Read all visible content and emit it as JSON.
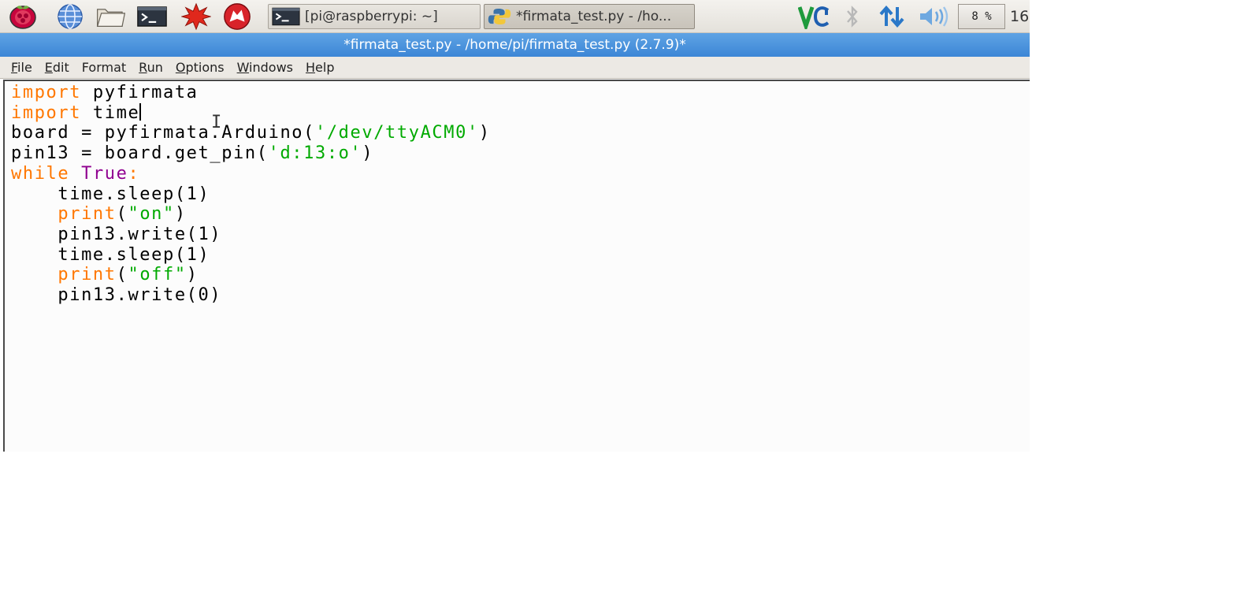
{
  "taskbar": {
    "launchers": [
      {
        "name": "raspberry-menu-icon"
      },
      {
        "name": "web-browser-icon"
      },
      {
        "name": "file-manager-icon"
      },
      {
        "name": "terminal-icon"
      },
      {
        "name": "mathematica-icon"
      },
      {
        "name": "wolfram-icon"
      }
    ],
    "tasks": [
      {
        "label": "[pi@raspberrypi: ~]",
        "icon": "terminal-icon",
        "active": false
      },
      {
        "label": "*firmata_test.py - /ho...",
        "icon": "python-icon",
        "active": true
      }
    ],
    "tray": {
      "vnc_icon": "vnc-icon",
      "bluetooth_icon": "bluetooth-icon",
      "network_icon": "network-icon",
      "volume_icon": "volume-icon",
      "cpu_value": "8",
      "cpu_unit": "%",
      "clock": "16"
    }
  },
  "window": {
    "title": "*firmata_test.py - /home/pi/firmata_test.py (2.7.9)*"
  },
  "menu": [
    {
      "mnemonic": "F",
      "rest": "ile"
    },
    {
      "mnemonic": "E",
      "rest": "dit"
    },
    {
      "mnemonic": "",
      "rest": "Format"
    },
    {
      "mnemonic": "R",
      "rest": "un"
    },
    {
      "mnemonic": "O",
      "rest": "ptions"
    },
    {
      "mnemonic": "W",
      "rest": "indows"
    },
    {
      "mnemonic": "H",
      "rest": "elp"
    }
  ],
  "editor": {
    "lines": [
      [
        {
          "t": "import",
          "c": "kw"
        },
        {
          "t": " pyfirmata",
          "c": ""
        }
      ],
      [
        {
          "t": "import",
          "c": "kw"
        },
        {
          "t": " time",
          "c": ""
        },
        {
          "t": "",
          "c": "caret"
        }
      ],
      [
        {
          "t": "board = pyfirmata.Arduino(",
          "c": ""
        },
        {
          "t": "'/dev/ttyACM0'",
          "c": "st"
        },
        {
          "t": ")",
          "c": ""
        }
      ],
      [
        {
          "t": "pin13 = board.get_pin(",
          "c": ""
        },
        {
          "t": "'d:13:o'",
          "c": "st"
        },
        {
          "t": ")",
          "c": ""
        }
      ],
      [
        {
          "t": "while",
          "c": "kw"
        },
        {
          "t": " ",
          "c": ""
        },
        {
          "t": "True",
          "c": "bi"
        },
        {
          "t": ":",
          "c": "kw"
        }
      ],
      [
        {
          "t": "    time.sleep(1)",
          "c": ""
        }
      ],
      [
        {
          "t": "    ",
          "c": ""
        },
        {
          "t": "print",
          "c": "kw"
        },
        {
          "t": "(",
          "c": ""
        },
        {
          "t": "\"on\"",
          "c": "st"
        },
        {
          "t": ")",
          "c": ""
        }
      ],
      [
        {
          "t": "    pin13.write(1)",
          "c": ""
        }
      ],
      [
        {
          "t": "    time.sleep(1)",
          "c": ""
        }
      ],
      [
        {
          "t": "    ",
          "c": ""
        },
        {
          "t": "print",
          "c": "kw"
        },
        {
          "t": "(",
          "c": ""
        },
        {
          "t": "\"off\"",
          "c": "st"
        },
        {
          "t": ")",
          "c": ""
        }
      ],
      [
        {
          "t": "    pin13.write(0)",
          "c": ""
        }
      ]
    ],
    "mouse_cursor": "I"
  }
}
